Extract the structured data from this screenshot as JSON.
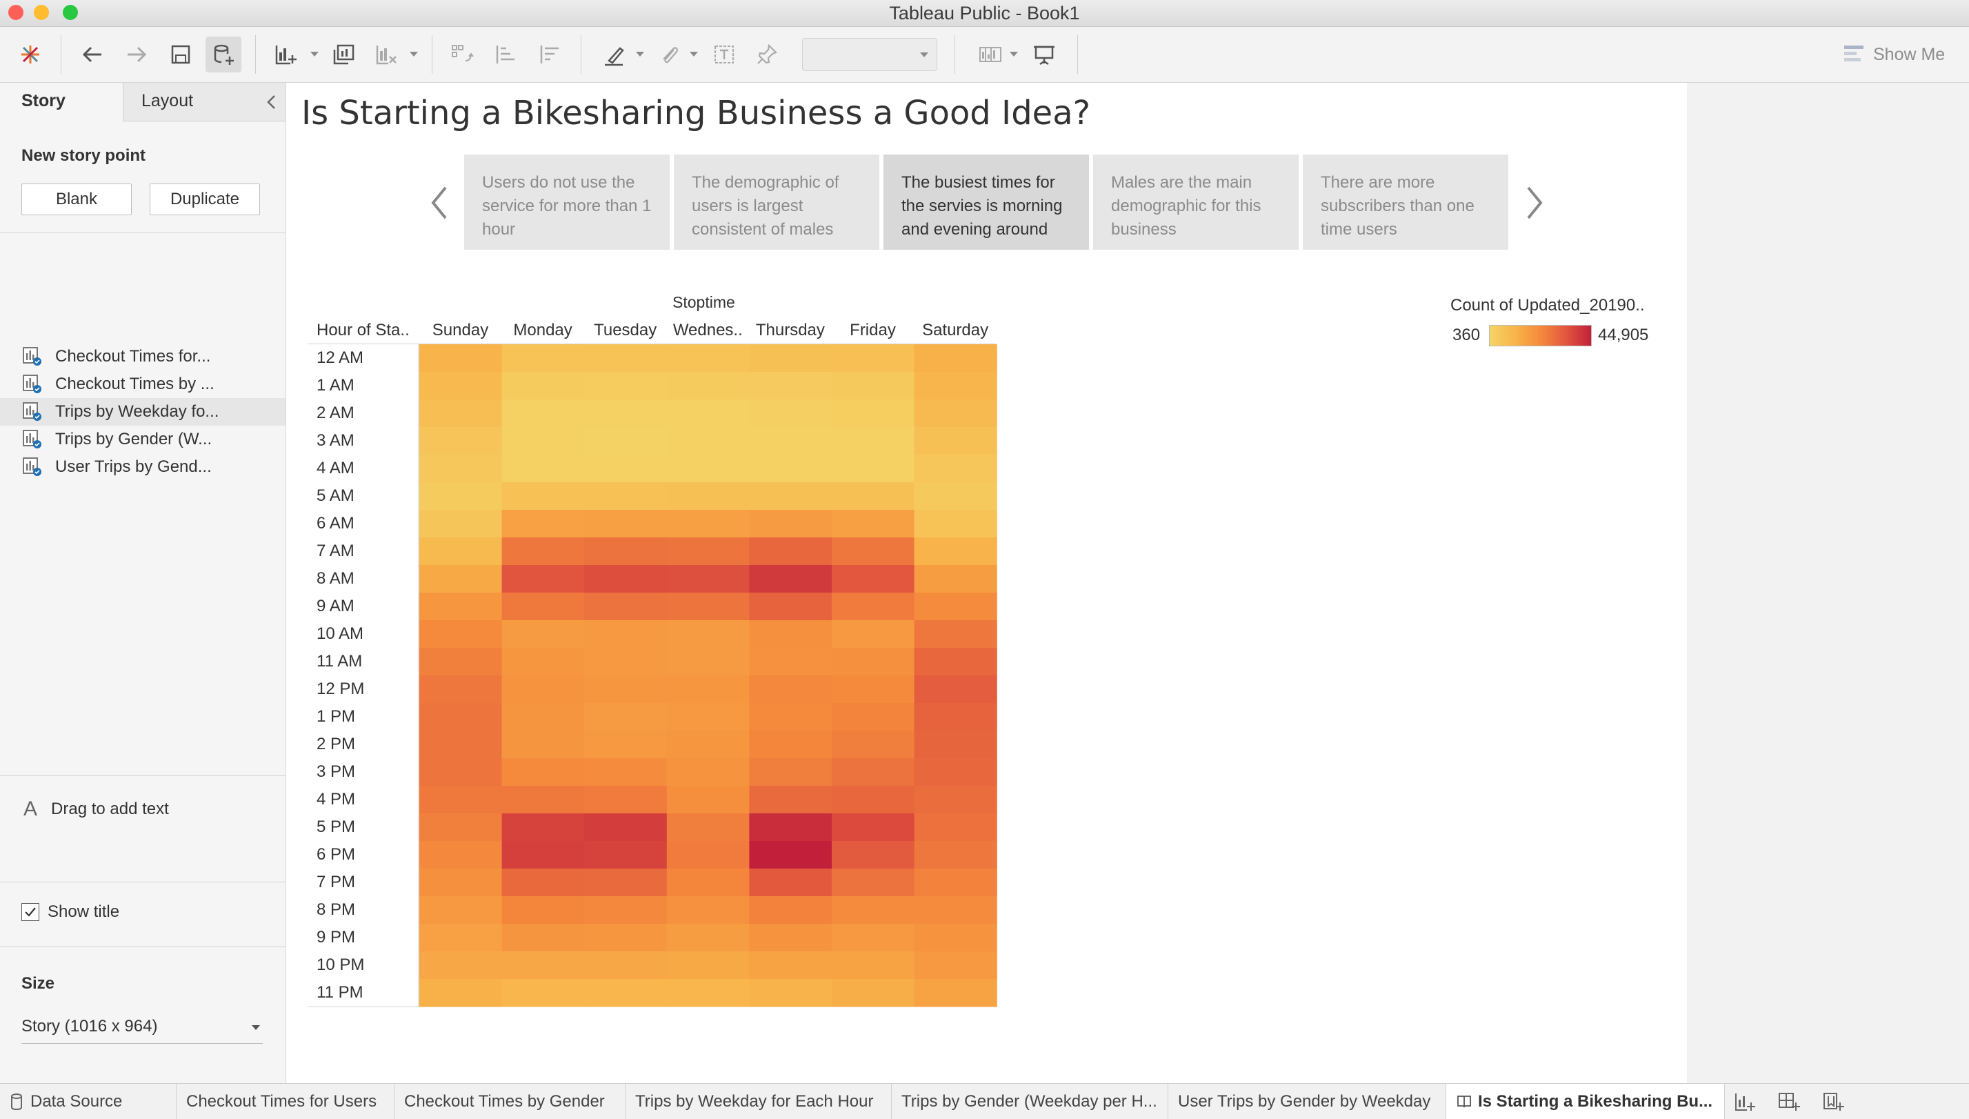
{
  "window": {
    "title": "Tableau Public - Book1",
    "traffic_lights": [
      "#fe5f57",
      "#febc2e",
      "#28c840"
    ]
  },
  "toolbar": {
    "icons": [
      "tableau-logo-icon",
      "back-icon",
      "forward-icon",
      "save-icon",
      "new-data-source-icon",
      "new-worksheet-icon",
      "duplicate-sheet-icon",
      "clear-sheet-icon",
      "swap-rows-columns-icon",
      "sort-ascending-icon",
      "sort-descending-icon",
      "highlight-icon",
      "group-icon",
      "show-labels-icon",
      "fix-axes-icon",
      "fit-dropdown",
      "show-cards-icon",
      "presentation-mode-icon"
    ],
    "fit_value": "",
    "show_me": "Show Me"
  },
  "left_pane": {
    "tab_story": "Story",
    "tab_layout": "Layout",
    "new_story_point": "New story point",
    "blank": "Blank",
    "duplicate": "Duplicate",
    "story_points": [
      {
        "label": "Checkout Times for...",
        "selected": false
      },
      {
        "label": "Checkout Times by ...",
        "selected": false
      },
      {
        "label": "Trips by Weekday fo...",
        "selected": true
      },
      {
        "label": "Trips by Gender (W...",
        "selected": false
      },
      {
        "label": "User Trips by Gend...",
        "selected": false
      }
    ],
    "drag_to_add_text": "Drag to add text",
    "drag_icon": "A",
    "show_title": "Show title",
    "show_title_checked": true,
    "size_label": "Size",
    "size_value": "Story (1016 x 964)"
  },
  "story": {
    "title": "Is Starting a Bikesharing Business a Good Idea?",
    "captions": [
      {
        "text": "Users do not use the service for more than 1 hour",
        "active": false
      },
      {
        "text": "The demographic of users is largest consistent of males",
        "active": false
      },
      {
        "text": "The busiest times for the servies is morning and evening around",
        "active": true
      },
      {
        "text": "Males are the main demographic for this business",
        "active": false
      },
      {
        "text": "There are more subscribers than one time users",
        "active": false
      }
    ]
  },
  "chart_data": {
    "type": "heatmap",
    "title": "",
    "column_group_label": "Stoptime",
    "row_header": "Hour of Sta..",
    "columns": [
      "Sunday",
      "Monday",
      "Tuesday",
      "Wednes..",
      "Thursday",
      "Friday",
      "Saturday"
    ],
    "rows": [
      "12 AM",
      "1 AM",
      "2 AM",
      "3 AM",
      "4 AM",
      "5 AM",
      "6 AM",
      "7 AM",
      "8 AM",
      "9 AM",
      "10 AM",
      "11 AM",
      "12 PM",
      "1 PM",
      "2 PM",
      "3 PM",
      "4 PM",
      "5 PM",
      "6 PM",
      "7 PM",
      "8 PM",
      "9 PM",
      "10 PM",
      "11 PM"
    ],
    "values": [
      [
        8500,
        4200,
        4000,
        4300,
        4600,
        5000,
        9000
      ],
      [
        6800,
        1900,
        1800,
        2000,
        2100,
        2500,
        7800
      ],
      [
        5200,
        1000,
        900,
        1000,
        1100,
        1400,
        6300
      ],
      [
        3600,
        700,
        650,
        700,
        750,
        900,
        4600
      ],
      [
        2600,
        900,
        850,
        900,
        900,
        1000,
        3200
      ],
      [
        1900,
        4500,
        4400,
        4600,
        4700,
        4600,
        2400
      ],
      [
        3300,
        13000,
        13500,
        13200,
        14500,
        13200,
        4000
      ],
      [
        6500,
        23500,
        24500,
        24000,
        27500,
        23500,
        8500
      ],
      [
        11000,
        32000,
        33500,
        33000,
        38500,
        31500,
        14000
      ],
      [
        15500,
        23000,
        24500,
        24000,
        28500,
        22500,
        18500
      ],
      [
        19000,
        14500,
        15000,
        14500,
        17500,
        15000,
        23500
      ],
      [
        21500,
        15500,
        15000,
        14500,
        17000,
        17500,
        27500
      ],
      [
        23500,
        16500,
        15500,
        15500,
        19500,
        19000,
        30000
      ],
      [
        24000,
        16000,
        14500,
        15000,
        19000,
        20500,
        28500
      ],
      [
        24000,
        16000,
        15000,
        15500,
        20000,
        22000,
        28000
      ],
      [
        24000,
        19000,
        18500,
        16500,
        22000,
        24500,
        27500
      ],
      [
        23000,
        23000,
        22500,
        18000,
        26500,
        27500,
        26000
      ],
      [
        21500,
        36500,
        37500,
        22000,
        42000,
        34500,
        25000
      ],
      [
        19500,
        37000,
        36500,
        22500,
        44905,
        30500,
        23500
      ],
      [
        17500,
        27000,
        26500,
        20000,
        31000,
        24500,
        21000
      ],
      [
        15000,
        20000,
        19500,
        17000,
        21000,
        18500,
        18500
      ],
      [
        13000,
        16000,
        15500,
        14000,
        16500,
        15000,
        16500
      ],
      [
        11500,
        11500,
        11500,
        11000,
        12500,
        12500,
        15000
      ],
      [
        9000,
        7500,
        7500,
        7500,
        8500,
        10000,
        12500
      ]
    ],
    "color_range": [
      360,
      44905
    ],
    "color_stops": [
      "#f5d466",
      "#f8b44a",
      "#f58a3c",
      "#e2573e",
      "#c2203a"
    ],
    "legend_title": "Count of Updated_20190..",
    "legend_min": "360",
    "legend_max": "44,905"
  },
  "bottom_tabs": {
    "data_source": "Data Source",
    "sheets": [
      {
        "label": "Checkout Times for Users",
        "active": false
      },
      {
        "label": "Checkout Times by Gender",
        "active": false
      },
      {
        "label": "Trips by Weekday for Each Hour",
        "active": false
      },
      {
        "label": "Trips by Gender (Weekday per H...",
        "active": false
      },
      {
        "label": "User Trips by Gender by Weekday",
        "active": false
      },
      {
        "label": "Is Starting a Bikesharing Bu...",
        "active": true
      }
    ],
    "icons": [
      "new-worksheet-icon",
      "new-dashboard-icon",
      "new-story-icon"
    ]
  }
}
